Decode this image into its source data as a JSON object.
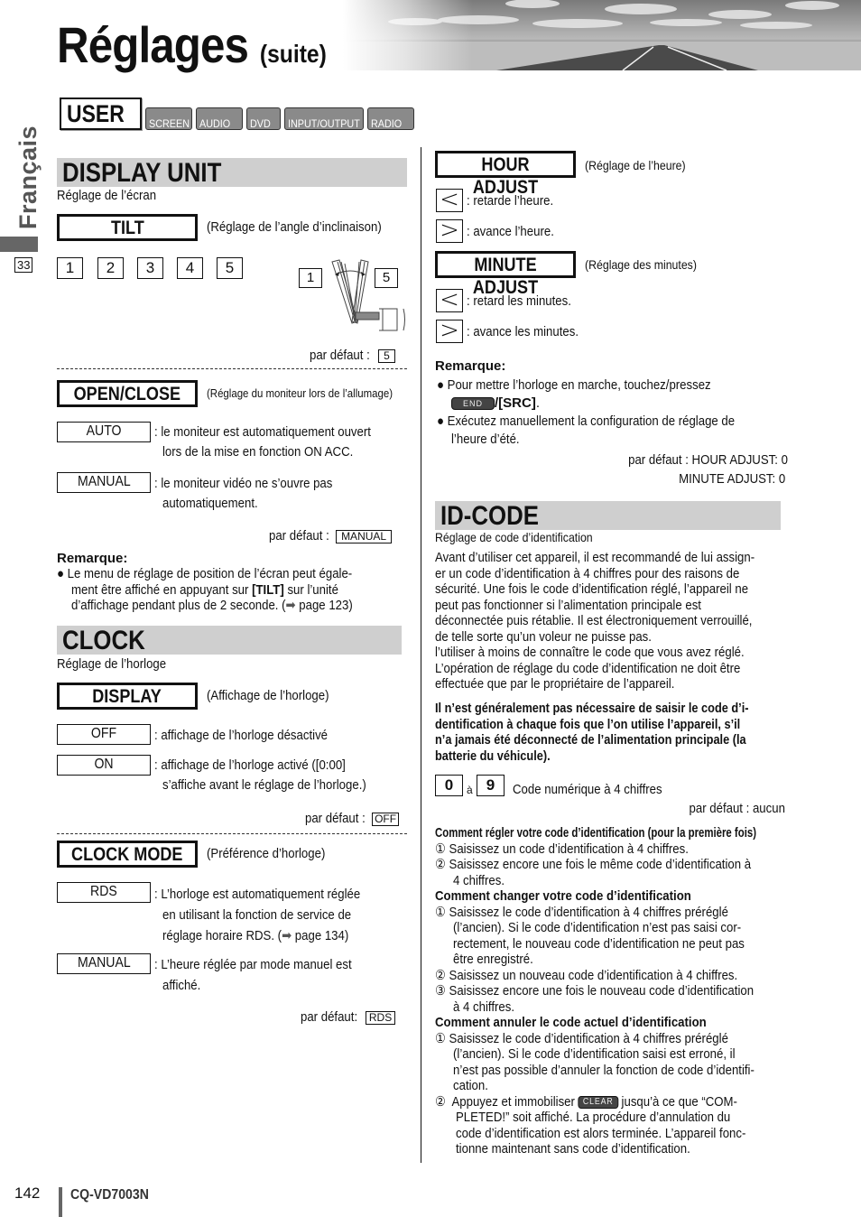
{
  "header": {
    "title": "Réglages",
    "title_suffix": "(suite)",
    "banner_image": "road-landscape-photo"
  },
  "mode_tabs": [
    {
      "label": "USER",
      "active": true
    },
    {
      "label": "SCREEN",
      "active": false
    },
    {
      "label": "AUDIO",
      "active": false
    },
    {
      "label": "DVD",
      "active": false
    },
    {
      "label": "INPUT/OUTPUT",
      "active": false
    },
    {
      "label": "RADIO",
      "active": false
    }
  ],
  "side_tab": {
    "language": "Français",
    "page_ref": "33"
  },
  "display_unit": {
    "heading": "DISPLAY UNIT",
    "subtitle": "Réglage de l’écran",
    "tilt": {
      "label": "TILT",
      "description": "(Réglage de l’angle d’inclinaison)",
      "values": [
        "1",
        "2",
        "3",
        "4",
        "5"
      ],
      "diagram_min": "1",
      "diagram_max": "5",
      "default_label": "par défaut :",
      "default_value": "5"
    },
    "open_close": {
      "label": "OPEN/CLOSE",
      "description": "(Réglage du moniteur lors de l’allumage)",
      "options": [
        {
          "value": "AUTO",
          "text": [
            ": le moniteur est automatiquement ouvert",
            "lors de la mise en fonction ON ACC."
          ]
        },
        {
          "value": "MANUAL",
          "text": [
            ": le moniteur vidéo ne s’ouvre pas",
            "automatiquement."
          ]
        }
      ],
      "default_label": "par défaut :",
      "default_value": "MANUAL"
    },
    "remark": {
      "title": "Remarque:",
      "lines": [
        "Le menu de réglage de position de l’écran peut égale-",
        "ment être affiché en appuyant sur ",
        "[TILT]",
        " sur l’unité",
        "d’affichage pendant plus de 2 seconde. (",
        " page 123)"
      ]
    }
  },
  "clock": {
    "heading": "CLOCK",
    "subtitle": "Réglage de l’horloge",
    "display": {
      "label": "DISPLAY",
      "description": "(Affichage de l’horloge)",
      "options": [
        {
          "value": "OFF",
          "text": [
            ": affichage de l’horloge désactivé"
          ]
        },
        {
          "value": "ON",
          "text": [
            ": affichage de l’horloge activé ([0:00]",
            "s’affiche avant le réglage de l’horloge.)"
          ]
        }
      ],
      "default_label": "par défaut :",
      "default_value": "OFF"
    },
    "clock_mode": {
      "label": "CLOCK MODE",
      "description": "(Préférence d’horloge)",
      "options": [
        {
          "value": "RDS",
          "text": [
            ": L’horloge est automatiquement réglée",
            "en utilisant la fonction de service de",
            "réglage horaire RDS. (",
            " page 134)"
          ]
        },
        {
          "value": "MANUAL",
          "text": [
            ": L’heure réglée par mode manuel est",
            "affiché."
          ]
        }
      ],
      "default_label": "par défaut:",
      "default_value": "RDS"
    },
    "hour_adjust": {
      "label": "HOUR ADJUST",
      "description": "(Réglage de l’heure)",
      "controls": [
        {
          "symbol": "<",
          "text": ": retarde l’heure."
        },
        {
          "symbol": ">",
          "text": ": avance l’heure."
        }
      ]
    },
    "minute_adjust": {
      "label": "MINUTE ADJUST",
      "description": "(Réglage des minutes)",
      "controls": [
        {
          "symbol": "<",
          "text": ": retard les minutes."
        },
        {
          "symbol": ">",
          "text": ": avance les minutes."
        }
      ]
    },
    "remark": {
      "title": "Remarque:",
      "line1": "Pour mettre l’horloge en marche, touchez/pressez",
      "key_end": "END",
      "key_src": "/[SRC]",
      "line1_end": ".",
      "line2a": "Exécutez manuellement la configuration de réglage de",
      "line2b": "l’heure d’été."
    },
    "defaults": [
      "par défaut : HOUR ADJUST: 0",
      "MINUTE ADJUST: 0"
    ]
  },
  "id_code": {
    "heading": "ID-CODE",
    "subtitle": "Réglage de code d’identification",
    "intro": [
      "Avant d’utiliser cet appareil, il est recommandé de lui assign-",
      "er un code d’identification à 4 chiffres pour des raisons de",
      "sécurité. Une fois le code d’identification réglé, l’appareil ne",
      "peut pas fonctionner si l’alimentation principale est",
      "déconnectée puis rétablie. Il est électroniquement verrouillé,",
      "de telle sorte qu’un voleur ne puisse pas.",
      "l’utiliser à moins de connaître le code que vous avez réglé.",
      "L’opération de réglage du code d’identification ne doit être",
      "effectuée que par le propriétaire de l’appareil."
    ],
    "note_bold": [
      "Il n’est généralement pas nécessaire de saisir le code d’i-",
      "dentification à chaque fois que l’on utilise l’appareil, s’il",
      "n’a jamais été déconnecté de l’alimentation principale (la",
      "batterie du véhicule)."
    ],
    "range": {
      "from": "0",
      "to_word": "à",
      "to": "9",
      "text": "Code numérique à 4 chiffres"
    },
    "default": "par défaut : aucun",
    "set_first": {
      "title": "Comment régler votre code d’identification (pour la première fois)",
      "steps": [
        {
          "num": "①",
          "lines": [
            "Saisissez un code d’identification à 4 chiffres."
          ]
        },
        {
          "num": "②",
          "lines": [
            "Saisissez encore une fois le même code d’identification à",
            "4 chiffres."
          ]
        }
      ]
    },
    "change": {
      "title": "Comment changer votre code d’identification",
      "steps": [
        {
          "num": "①",
          "lines": [
            "Saisissez le code d’identification à 4 chiffres préréglé",
            "(l’ancien). Si le code d’identification n’est pas saisi cor-",
            "rectement, le nouveau code d’identification ne peut pas",
            "être enregistré."
          ]
        },
        {
          "num": "②",
          "lines": [
            "Saisissez un nouveau code d’identification à 4 chiffres."
          ]
        },
        {
          "num": "③",
          "lines": [
            "Saisissez encore une fois le nouveau code d’identification",
            "à 4 chiffres."
          ]
        }
      ]
    },
    "cancel": {
      "title": "Comment annuler le code actuel d’identification",
      "step1": {
        "num": "①",
        "lines": [
          "Saisissez le code d’identification à 4 chiffres préréglé",
          "(l’ancien). Si le code d’identification saisi est erroné, il",
          "n’est pas possible d’annuler la fonction de code d’identifi-",
          "cation."
        ]
      },
      "step2": {
        "num": "②",
        "pre": "Appuyez et immobiliser ",
        "key": "CLEAR",
        "post": " jusqu’à ce que “COM-",
        "lines": [
          "PLETED!” soit affiché.  La procédure d’annulation du",
          "code d’identification est alors terminée. L’appareil fonc-",
          "tionne maintenant sans code d’identification."
        ]
      }
    }
  },
  "footer": {
    "page_number": "142",
    "model": "CQ-VD7003N"
  }
}
